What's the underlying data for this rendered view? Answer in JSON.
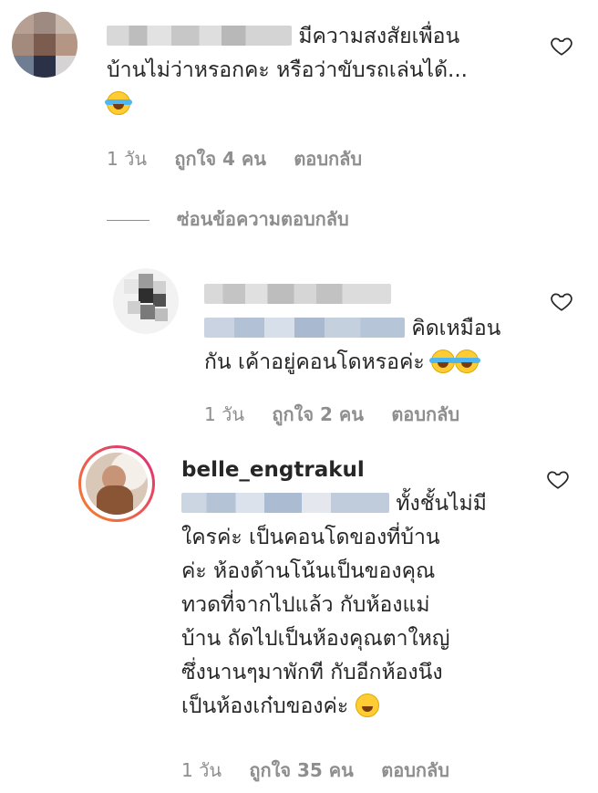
{
  "comments": [
    {
      "text_lines": [
        "มีความสงสัยเพื่อน",
        "บ้านไม่ว่าหรอกคะ หรือว่าขับรถเล่นได้..."
      ],
      "emoji": "face-with-tears-of-joy",
      "time": "1 วัน",
      "likes": "ถูกใจ 4 คน",
      "reply": "ตอบกลับ",
      "hide_replies": "ซ่อนข้อความตอบกลับ"
    },
    {
      "text_lines": [
        "คิดเหมือน",
        "กัน เค้าอยู่คอนโดหรอค่ะ"
      ],
      "emoji": "face-with-tears-of-joy",
      "time": "1 วัน",
      "likes": "ถูกใจ 2 คน",
      "reply": "ตอบกลับ"
    },
    {
      "username": "belle_engtrakul",
      "text_lines": [
        "ทั้งชั้นไม่มี",
        "ใครค่ะ เป็นคอนโดของที่บ้าน",
        "ค่ะ ห้องด้านโน้นเป็นของคุณ",
        "ทวดที่จากไปแล้ว กับห้องแม่",
        "บ้าน ถัดไปเป็นห้องคุณตาใหญ่",
        "ซึ่งนานๆมาพักที กับอีกห้องนึง",
        "เป็นห้องเก๋บของค่ะ"
      ],
      "emoji": "grinning-face-with-smiling-eyes",
      "time": "1 วัน",
      "likes": "ถูกใจ 35 คน",
      "reply": "ตอบกลับ"
    }
  ],
  "icons": {
    "like": "heart-outline-icon"
  },
  "colors": {
    "text": "#262626",
    "meta": "#8e8e8e",
    "story_ring_start": "#f58529",
    "story_ring_end": "#dd2a7b"
  }
}
